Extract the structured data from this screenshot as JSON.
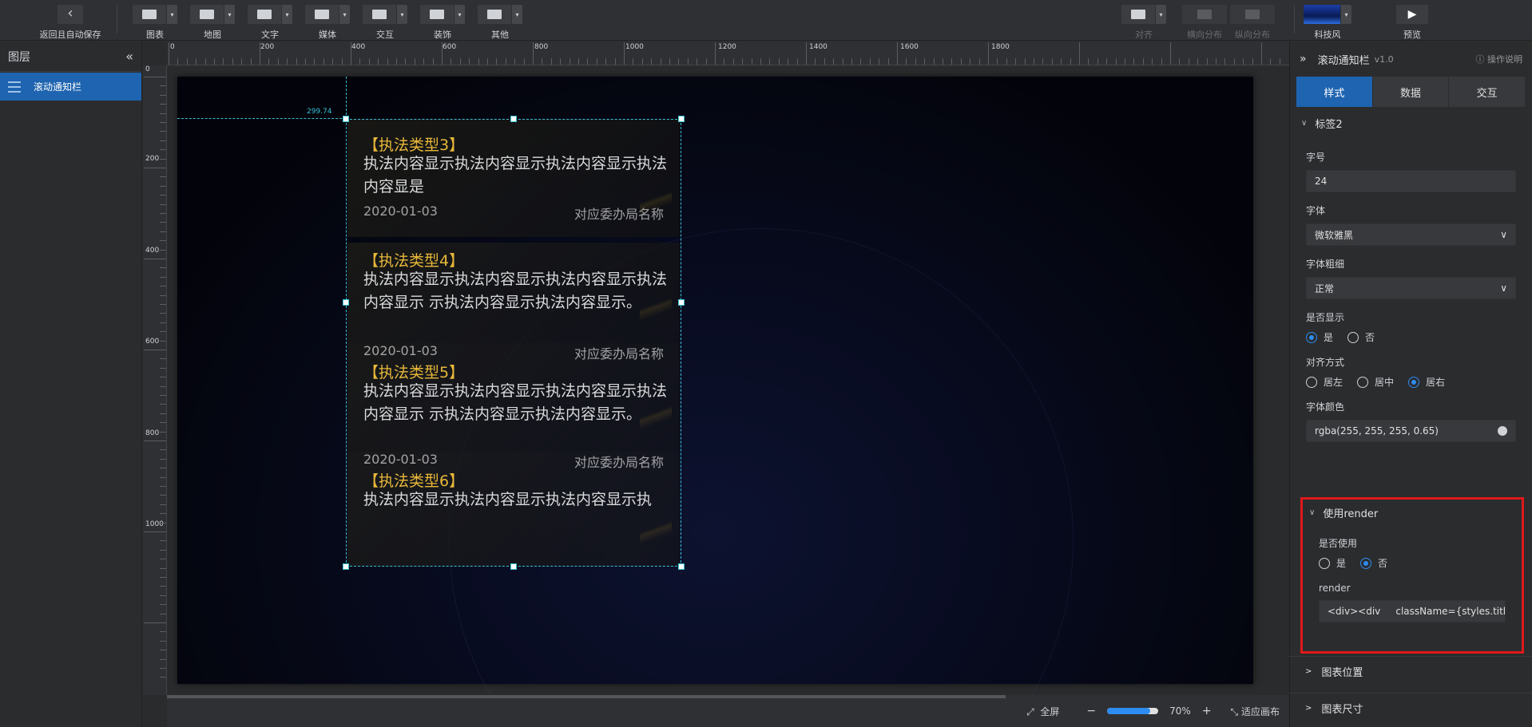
{
  "toolbar": {
    "back_label": "返回且自动保存",
    "groups": [
      "图表",
      "地图",
      "文字",
      "媒体",
      "交互",
      "装饰",
      "其他"
    ],
    "align": {
      "label": "对齐",
      "h_dist": "横向分布",
      "v_dist": "纵向分布"
    },
    "theme_label": "科技风",
    "preview_label": "预览"
  },
  "layers": {
    "title": "图层",
    "items": [
      {
        "label": "滚动通知栏"
      }
    ]
  },
  "ruler": {
    "top": [
      "0",
      "200",
      "400",
      "600",
      "800",
      "1000",
      "1200",
      "1400",
      "1600",
      "1800"
    ],
    "left": [
      "0",
      "200",
      "400",
      "600",
      "800",
      "1000"
    ],
    "guide_value": "299.74"
  },
  "notices": [
    {
      "type": "【执法类型3】",
      "body": "执法内容显示执法内容显示执法内容显示执法内容显是",
      "date": "2020-01-03",
      "org": "对应委办局名称"
    },
    {
      "type": "【执法类型4】",
      "body": "执法内容显示执法内容显示执法内容显示执法内容显示 示执法内容显示执法内容显示。",
      "date": "2020-01-03",
      "org": "对应委办局名称"
    },
    {
      "type": "【执法类型5】",
      "body": "执法内容显示执法内容显示执法内容显示执法内容显示 示执法内容显示执法内容显示。",
      "date": "2020-01-03",
      "org": "对应委办局名称"
    },
    {
      "type": "【执法类型6】",
      "body": "执法内容显示执法内容显示执法内容显示执",
      "date": "",
      "org": ""
    }
  ],
  "bottom_bar": {
    "fullscreen": "全屏",
    "zoom": "70%",
    "fit": "适应画布"
  },
  "panel": {
    "title": "滚动通知栏",
    "version": "v1.0",
    "help": "操作说明",
    "tabs": [
      "样式",
      "数据",
      "交互"
    ],
    "section_label": "标签2",
    "font_size_label": "字号",
    "font_size_value": "24",
    "font_family_label": "字体",
    "font_family_value": "微软雅黑",
    "font_weight_label": "字体粗细",
    "font_weight_value": "正常",
    "show_label": "是否显示",
    "show_yes": "是",
    "show_no": "否",
    "align_label": "对齐方式",
    "align_left": "居左",
    "align_center": "居中",
    "align_right": "居右",
    "color_label": "字体颜色",
    "color_value": "rgba(255, 255, 255, 0.65)",
    "render_section": "使用render",
    "use_label": "是否使用",
    "use_yes": "是",
    "use_no": "否",
    "render_label": "render",
    "render_value": "<div><div     className={styles.titl",
    "collapsed": [
      "图表位置",
      "图表尺寸"
    ]
  }
}
